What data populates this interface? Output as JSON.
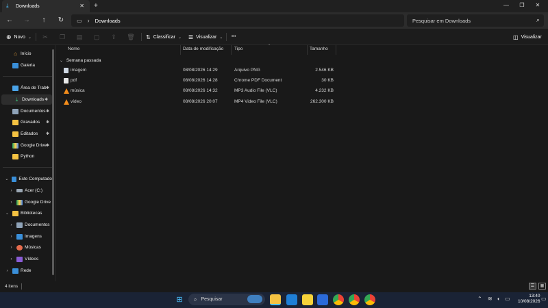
{
  "window": {
    "tab_title": "Downloads",
    "new_tab": "+",
    "tab_close": "✕",
    "minimize": "—",
    "maximize": "❐",
    "close": "✕"
  },
  "address": {
    "crumb_sep": "›",
    "current": "Downloads",
    "search_placeholder": "Pesquisar em Downloads"
  },
  "toolbar": {
    "new_label": "Novo",
    "sort_label": "Classificar",
    "view_label": "Visualizar",
    "more_label": "•••",
    "preview_label": "Visualizar"
  },
  "columns": {
    "name": "Nome",
    "modified": "Data de modificação",
    "type": "Tipo",
    "size": "Tamanho"
  },
  "group": {
    "label": "Semana passada"
  },
  "files": [
    {
      "name": "imagem",
      "modified": "08/08/2026 14:29",
      "type": "Arquivo PNG",
      "size": "2.546 KB",
      "icon": "image-file-icon"
    },
    {
      "name": "pdf",
      "modified": "08/08/2026 14:28",
      "type": "Chrome PDF Document",
      "size": "30 KB",
      "icon": "pdf-file-icon"
    },
    {
      "name": "música",
      "modified": "08/08/2026 14:32",
      "type": "MP3 Audio File (VLC)",
      "size": "4.232 KB",
      "icon": "vlc-icon"
    },
    {
      "name": "vídeo",
      "modified": "08/08/2026 20:07",
      "type": "MP4 Video File (VLC)",
      "size": "262.300 KB",
      "icon": "vlc-icon"
    }
  ],
  "sidebar": {
    "quick": [
      {
        "label": "Início"
      },
      {
        "label": "Galeria"
      }
    ],
    "pinned": [
      {
        "label": "Área de Trab"
      },
      {
        "label": "Downloads"
      },
      {
        "label": "Documentos"
      },
      {
        "label": "Gravados"
      },
      {
        "label": "Editados"
      },
      {
        "label": "Google Drive"
      },
      {
        "label": "Python"
      }
    ],
    "tree": [
      {
        "label": "Este Computador"
      },
      {
        "label": "Acer (C:)"
      },
      {
        "label": "Google Drive ("
      },
      {
        "label": "Bibliotecas"
      },
      {
        "label": "Documentos"
      },
      {
        "label": "Imagens"
      },
      {
        "label": "Músicas"
      },
      {
        "label": "Vídeos"
      },
      {
        "label": "Rede"
      }
    ]
  },
  "status": {
    "count": "4 itens"
  },
  "taskbar": {
    "search_placeholder": "Pesquisar",
    "time": "13:40",
    "date": "10/08/2026"
  },
  "colors": {
    "accent": "#4cc2ff",
    "folder": "#f4c242",
    "vlc": "#f28c1b",
    "taskbar": "#1a2335"
  }
}
